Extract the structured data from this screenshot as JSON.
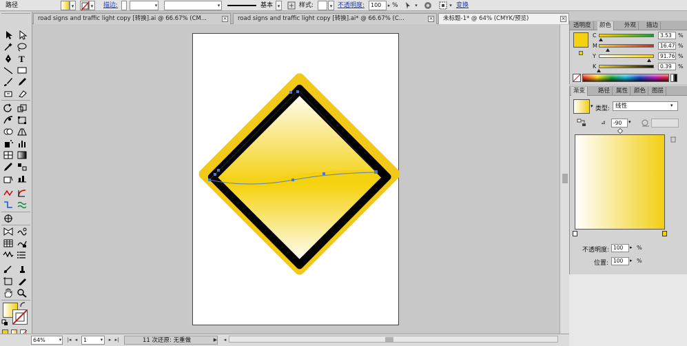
{
  "control_bar": {
    "path_label": "路径",
    "stroke_label": "描边:",
    "stroke_profile": "基本",
    "style_label": "样式:",
    "opacity_label": "不透明度:",
    "opacity_value": "100",
    "opacity_unit": "%",
    "transform_label": "变换"
  },
  "document_tabs": [
    {
      "label": "road signs and traffic light copy [转换].ai @ 66.67% (CM...",
      "active": false
    },
    {
      "label": "road signs and traffic light copy [转换].ai* @ 66.67% (C...",
      "active": false
    },
    {
      "label": "未标题-1* @ 64% (CMYK/预览)",
      "active": true
    }
  ],
  "color_panel": {
    "tabs": [
      "透明度",
      "颜色",
      "外观",
      "描边"
    ],
    "active_tab": "颜色",
    "channels": [
      {
        "name": "C",
        "value": "3.53",
        "amount": 0.0353
      },
      {
        "name": "M",
        "value": "16.47",
        "amount": 0.1647
      },
      {
        "name": "Y",
        "value": "91.76",
        "amount": 0.9176
      },
      {
        "name": "K",
        "value": "0.39",
        "amount": 0.0039
      }
    ],
    "fill_color": "#f5d20f"
  },
  "gradient_panel": {
    "tabs": [
      "渐变",
      "路径",
      "属性",
      "颜色",
      "图层"
    ],
    "active_tab": "渐变",
    "type_label": "类型:",
    "type_value": "线性",
    "angle_value": "-90",
    "opacity_label": "不透明度:",
    "opacity_value": "100",
    "position_label": "位置:",
    "position_value": "100",
    "unit": "%",
    "start_color": "#ffffff",
    "end_color": "#f3cf14"
  },
  "status_bar": {
    "zoom": "64%",
    "page": "1",
    "message": "11 次还原: 无重做"
  },
  "canvas": {
    "sign_outer_color": "#f2c919",
    "sign_border_color": "#000000",
    "sign_fill_color": "#f5d20f",
    "path_color": "#5b7fb7"
  },
  "icons": [
    "selection-tool-icon",
    "direct-selection-tool-icon",
    "magic-wand-icon",
    "lasso-icon",
    "pen-tool-icon",
    "type-tool-icon",
    "line-tool-icon",
    "rectangle-tool-icon",
    "paintbrush-icon",
    "pencil-icon",
    "eraser-icon",
    "rotate-icon",
    "scale-icon",
    "warp-icon",
    "free-transform-icon",
    "symbol-sprayer-icon",
    "graph-icon",
    "mesh-icon",
    "gradient-tool-icon",
    "eyedropper-icon",
    "blend-icon",
    "slice-icon",
    "hand-icon",
    "zoom-icon",
    "fill-swatch-icon",
    "stroke-swatch-icon",
    "screen-mode-icon"
  ]
}
